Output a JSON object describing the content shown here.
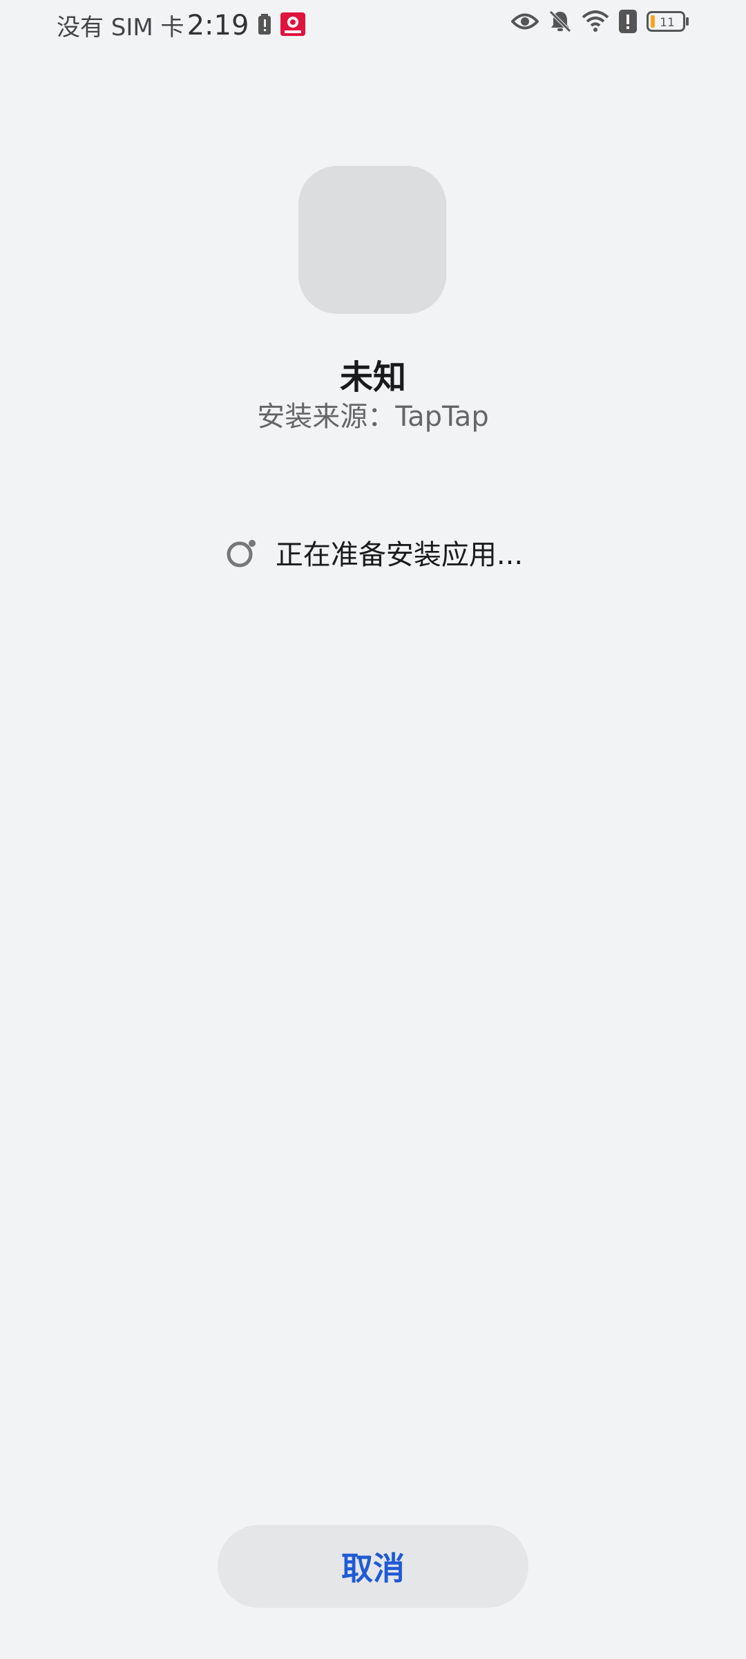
{
  "status_bar": {
    "carrier": "没有 SIM 卡",
    "time": "2:19",
    "battery_level": "11",
    "icons": [
      "battery-alert-icon",
      "app-notification-icon",
      "eye-icon",
      "bell-muted-icon",
      "wifi-icon",
      "alert-icon",
      "battery-icon"
    ]
  },
  "app": {
    "name": "未知",
    "source": "安装来源：TapTap"
  },
  "progress": {
    "text": "正在准备安装应用..."
  },
  "actions": {
    "cancel_label": "取消"
  },
  "colors": {
    "background": "#f2f3f5",
    "accent": "#1f5bd6",
    "battery_low": "#f5a623"
  }
}
